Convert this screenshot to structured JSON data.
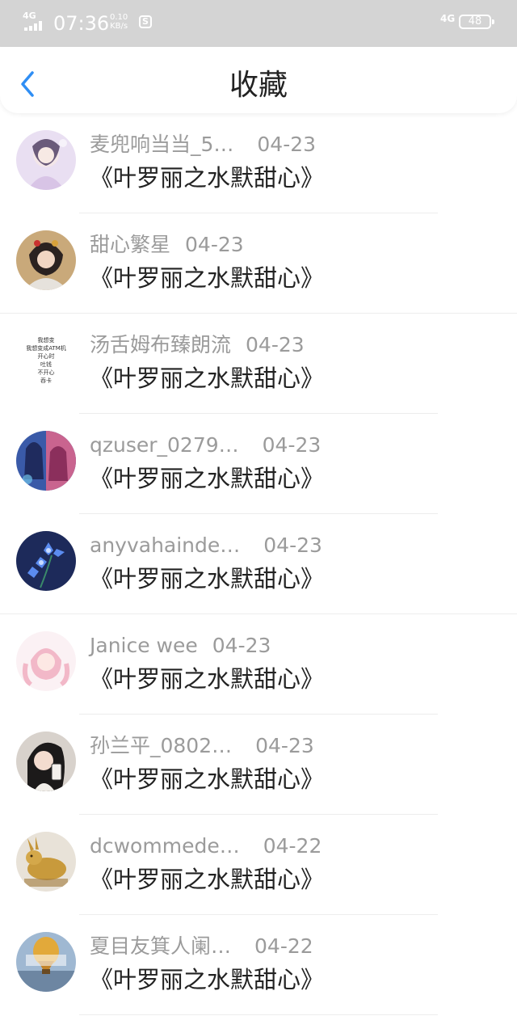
{
  "status_bar": {
    "network": "4G",
    "time": "07:36",
    "speed_value": "0.10",
    "speed_unit": "KB/s",
    "network_right": "4G",
    "battery": "48"
  },
  "header": {
    "title": "收藏"
  },
  "favorites": [
    {
      "user": "麦兜响当当_5…",
      "date": "04-23",
      "title": "《叶罗丽之水默甜心》"
    },
    {
      "user": "甜心繁星",
      "date": "04-23",
      "title": "《叶罗丽之水默甜心》"
    },
    {
      "user": "汤舌姆布臻朗流",
      "date": "04-23",
      "title": "《叶罗丽之水默甜心》"
    },
    {
      "user": "qzuser_0279…",
      "date": "04-23",
      "title": "《叶罗丽之水默甜心》"
    },
    {
      "user": "anyvahainde…",
      "date": "04-23",
      "title": "《叶罗丽之水默甜心》"
    },
    {
      "user": "Janice wee",
      "date": "04-23",
      "title": "《叶罗丽之水默甜心》"
    },
    {
      "user": "孙兰平_0802…",
      "date": "04-23",
      "title": "《叶罗丽之水默甜心》"
    },
    {
      "user": "dcwommede…",
      "date": "04-22",
      "title": "《叶罗丽之水默甜心》"
    },
    {
      "user": "夏目友箕人阑…",
      "date": "04-22",
      "title": "《叶罗丽之水默甜心》"
    }
  ],
  "text_avatar_lines": [
    "我想变",
    "我想变成ATM机",
    "开心时",
    "吐钱",
    "不开心",
    "吞卡"
  ],
  "colors": {
    "accent": "#2f8ef4",
    "status_bar_bg": "#d4d4d4",
    "username": "#9b9b9b",
    "title_text": "#222222"
  }
}
